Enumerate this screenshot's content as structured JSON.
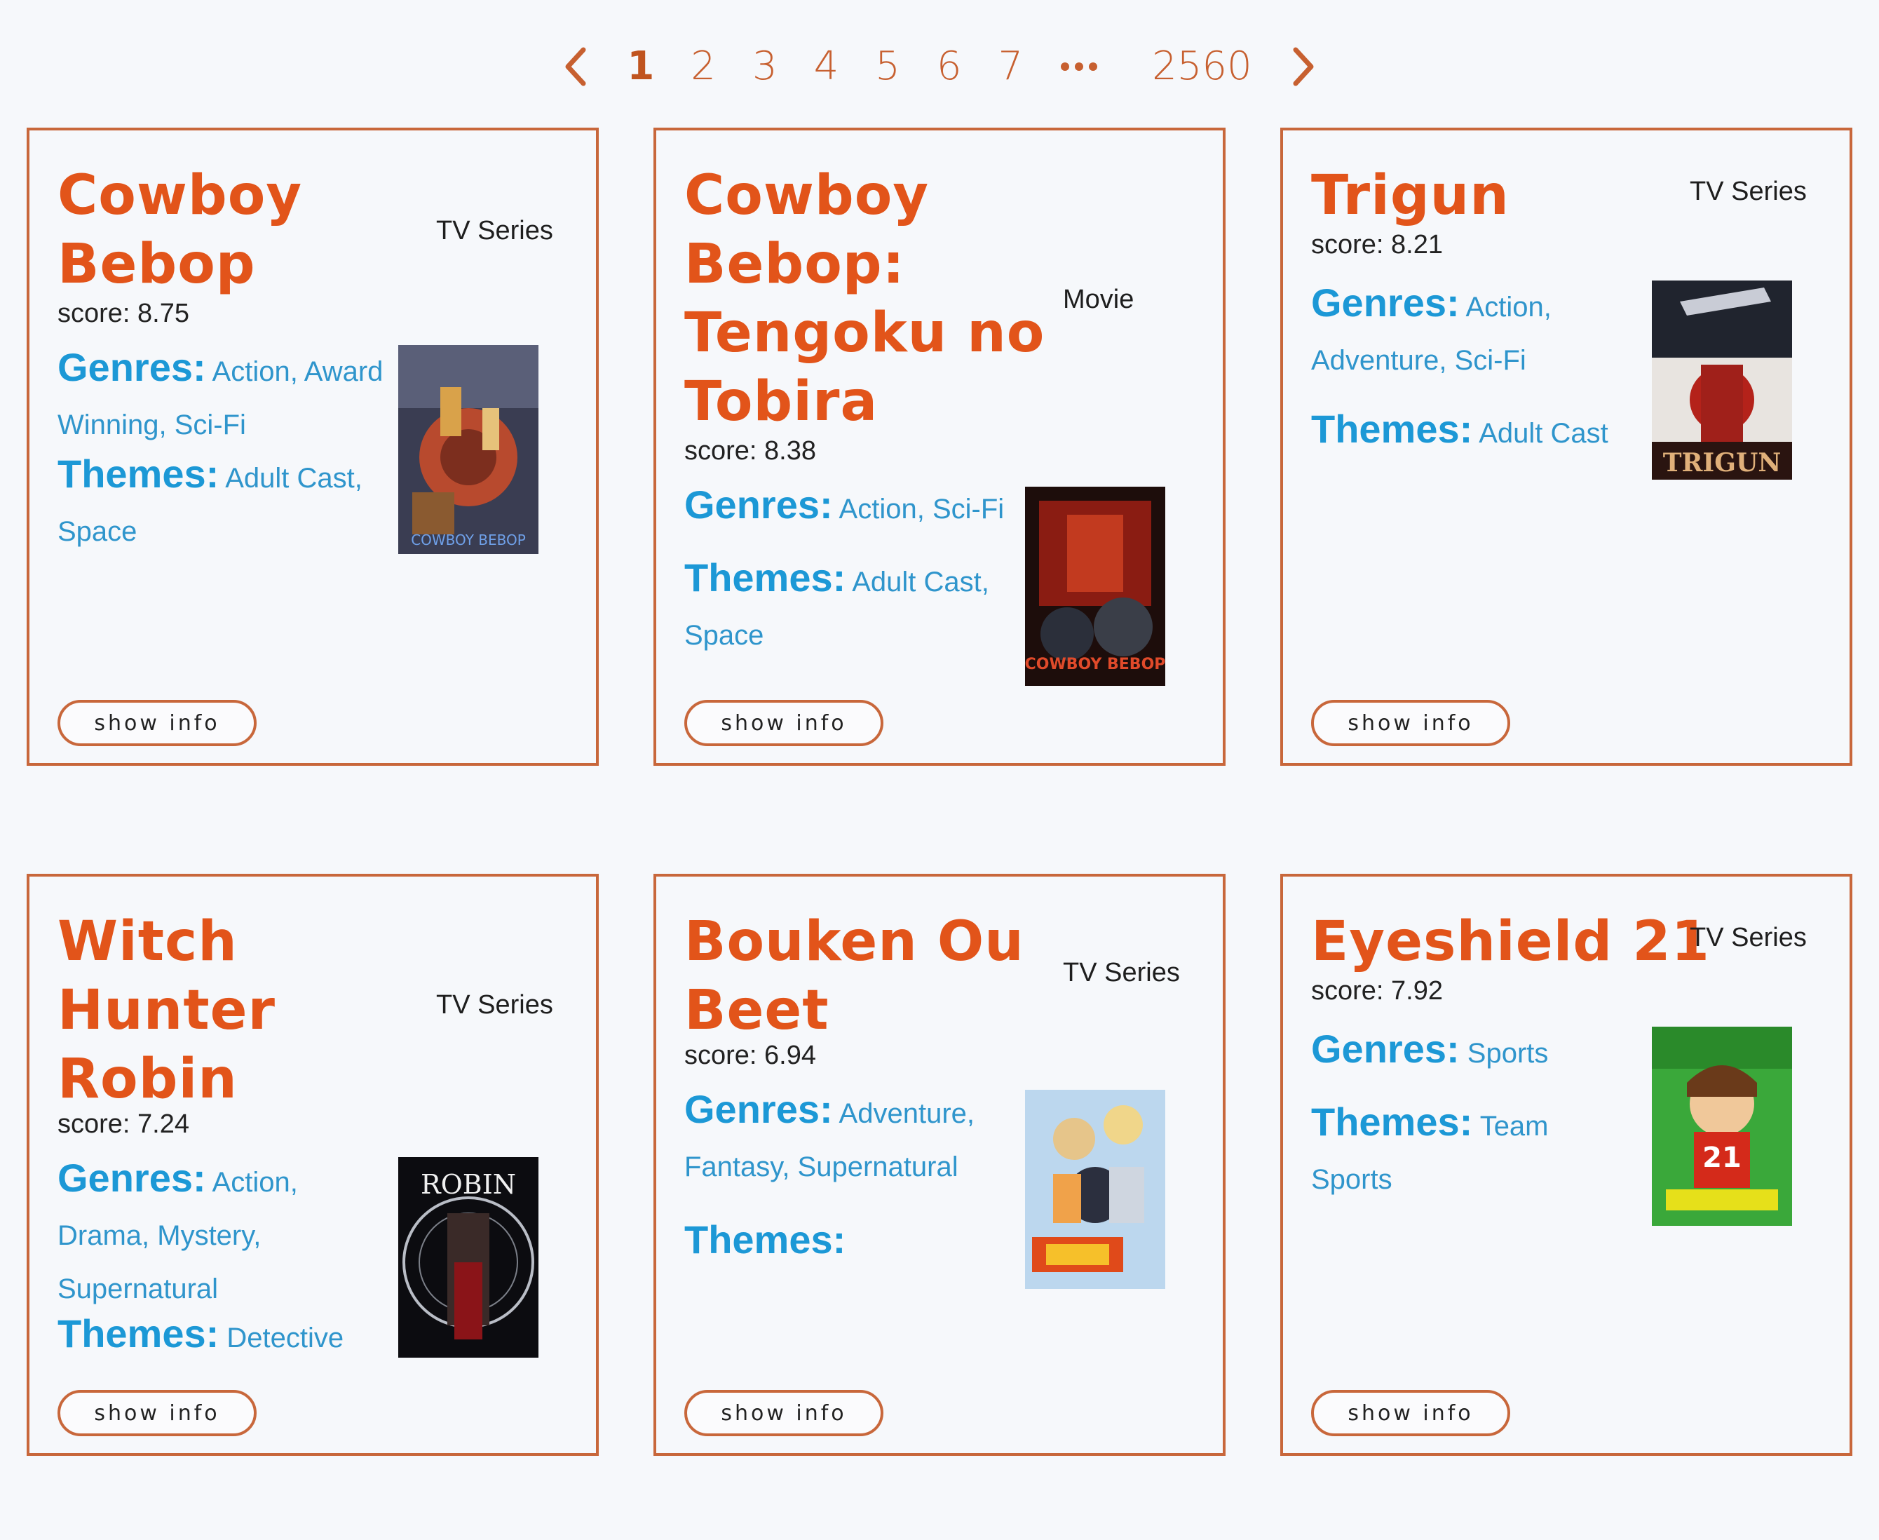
{
  "pagination": {
    "pages": [
      "1",
      "2",
      "3",
      "4",
      "5",
      "6",
      "7"
    ],
    "current": "1",
    "last": "2560",
    "prev_icon": "chevron-left-icon",
    "next_icon": "chevron-right-icon",
    "ellipsis_icon": "more-horizontal-icon"
  },
  "labels": {
    "genres": "Genres:",
    "themes": "Themes:",
    "show_info": "show info",
    "score_prefix": "score:"
  },
  "colors": {
    "title": "#e2541a",
    "accent_border": "#c8673b",
    "info_blue": "#1c98d6",
    "background": "#f6f8fb"
  },
  "cards": [
    {
      "title": "Cowboy Bebop",
      "type": "TV Series",
      "score": "score: 8.75",
      "genres": "Action, Award Winning, Sci-Fi",
      "themes": "Adult Cast, Space",
      "poster_text": "COWBOY BEBOP"
    },
    {
      "title": "Cowboy Bebop: Tengoku no Tobira",
      "type": "Movie",
      "score": "score: 8.38",
      "genres": "Action, Sci-Fi",
      "themes": "Adult Cast, Space",
      "poster_text": "COWBOY BEBOP"
    },
    {
      "title": "Trigun",
      "type": "TV Series",
      "score": "score: 8.21",
      "genres": "Action, Adventure, Sci-Fi",
      "themes": "Adult Cast",
      "poster_text": "TRIGUN"
    },
    {
      "title": "Witch Hunter Robin",
      "type": "TV Series",
      "score": "score: 7.24",
      "genres": "Action, Drama, Mystery, Supernatural",
      "themes": "Detective",
      "poster_text": "ROBIN"
    },
    {
      "title": "Bouken Ou Beet",
      "type": "TV Series",
      "score": "score: 6.94",
      "genres": "Adventure, Fantasy, Supernatural",
      "themes": "",
      "poster_text": ""
    },
    {
      "title": "Eyeshield 21",
      "type": "TV Series",
      "score": "score: 7.92",
      "genres": "Sports",
      "themes": "Team Sports",
      "poster_text": ""
    }
  ]
}
